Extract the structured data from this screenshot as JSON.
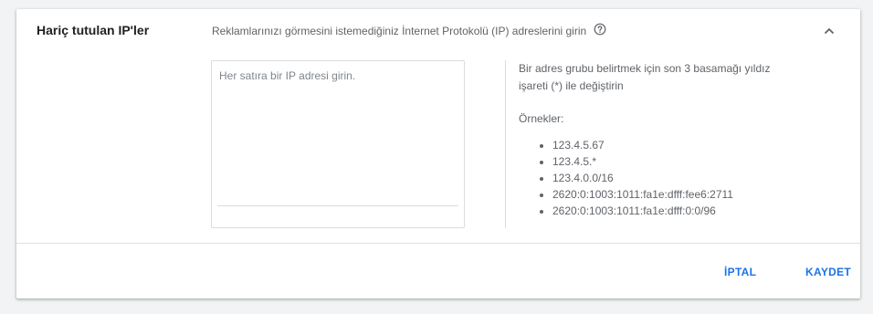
{
  "section": {
    "title": "Hariç tutulan IP'ler",
    "description": "Reklamlarınızı görmesini istemediğiniz İnternet Protokolü (IP) adreslerini girin",
    "help_icon": "help-circle-icon",
    "collapse_icon": "chevron-up-icon"
  },
  "input": {
    "value": "",
    "placeholder": "Her satıra bir IP adresi girin."
  },
  "help": {
    "text": "Bir adres grubu belirtmek için son 3 basamağı yıldız işareti (*) ile değiştirin",
    "examples_label": "Örnekler:",
    "examples": [
      "123.4.5.67",
      "123.4.5.*",
      "123.4.0.0/16",
      "2620:0:1003:1011:fa1e:dfff:fee6:2711",
      "2620:0:1003:1011:fa1e:dfff:0:0/96"
    ]
  },
  "actions": {
    "cancel_label": "İPTAL",
    "save_label": "KAYDET"
  },
  "colors": {
    "accent": "#1a73e8",
    "text_primary": "#202124",
    "text_secondary": "#5f6368"
  }
}
